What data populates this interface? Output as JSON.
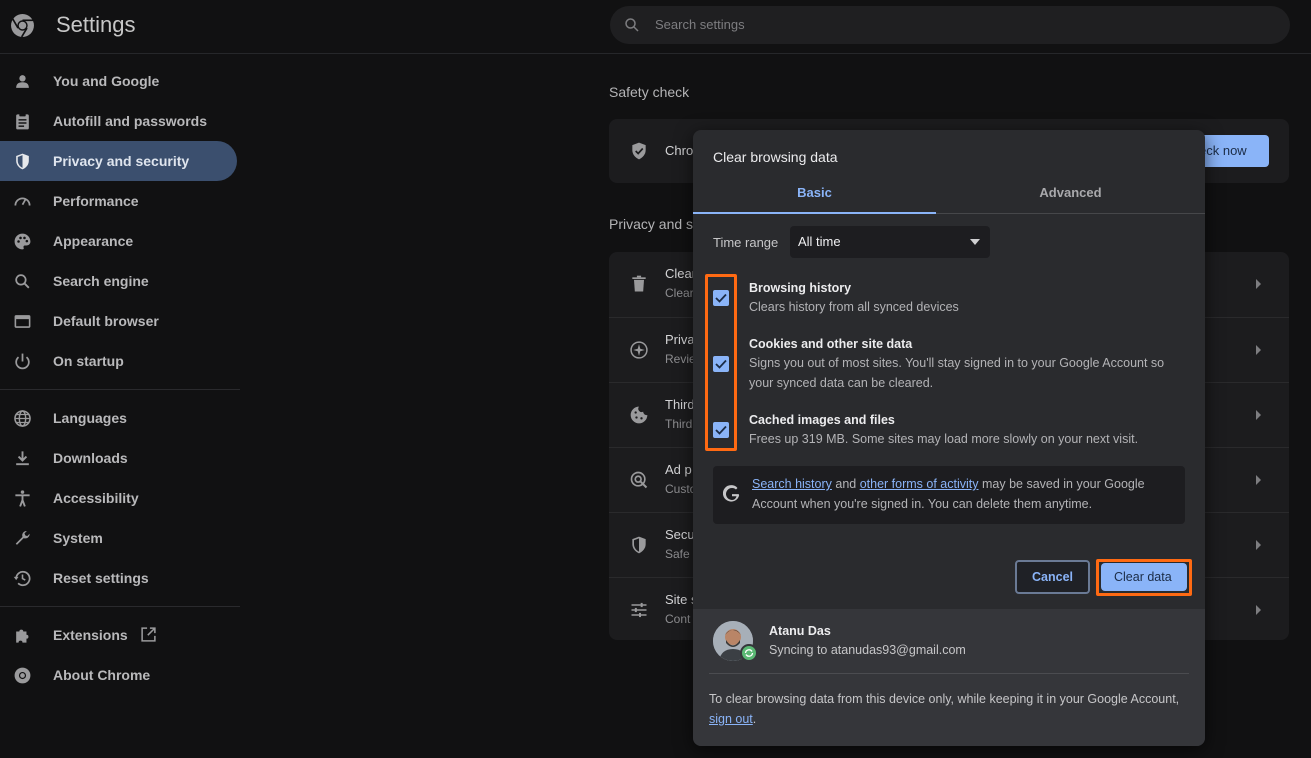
{
  "app": {
    "title": "Settings"
  },
  "search": {
    "placeholder": "Search settings"
  },
  "sidebar": {
    "items": [
      {
        "label": "You and Google",
        "icon": "person-icon"
      },
      {
        "label": "Autofill and passwords",
        "icon": "clipboard-icon"
      },
      {
        "label": "Privacy and security",
        "icon": "shield-icon",
        "active": true
      },
      {
        "label": "Performance",
        "icon": "speedometer-icon"
      },
      {
        "label": "Appearance",
        "icon": "palette-icon"
      },
      {
        "label": "Search engine",
        "icon": "search-icon"
      },
      {
        "label": "Default browser",
        "icon": "browser-icon"
      },
      {
        "label": "On startup",
        "icon": "power-icon"
      }
    ],
    "items2": [
      {
        "label": "Languages",
        "icon": "globe-icon"
      },
      {
        "label": "Downloads",
        "icon": "download-icon"
      },
      {
        "label": "Accessibility",
        "icon": "accessibility-icon"
      },
      {
        "label": "System",
        "icon": "wrench-icon"
      },
      {
        "label": "Reset settings",
        "icon": "history-icon"
      }
    ],
    "items3": [
      {
        "label": "Extensions",
        "icon": "puzzle-icon"
      },
      {
        "label": "About Chrome",
        "icon": "chrome-icon"
      }
    ]
  },
  "main": {
    "safety_title": "Safety check",
    "safety_row_text": "Chro",
    "check_now_label": "eck now",
    "privacy_title": "Privacy and s",
    "rows": [
      {
        "title": "Clear",
        "sub": "Clear",
        "icon": "trash-icon"
      },
      {
        "title": "Priva",
        "sub": "Revie",
        "icon": "compass-icon"
      },
      {
        "title": "Third",
        "sub": "Third",
        "icon": "cookie-icon"
      },
      {
        "title": "Ad p",
        "sub": "Custo",
        "icon": "ad-privacy-icon"
      },
      {
        "title": "Secu",
        "sub": "Safe",
        "icon": "security-shield-icon"
      },
      {
        "title": "Site s",
        "sub": "Cont",
        "icon": "sliders-icon"
      }
    ]
  },
  "dialog": {
    "title": "Clear browsing data",
    "tabs": [
      "Basic",
      "Advanced"
    ],
    "time_range_label": "Time range",
    "time_range_value": "All time",
    "options": [
      {
        "title": "Browsing history",
        "desc": "Clears history from all synced devices",
        "checked": true
      },
      {
        "title": "Cookies and other site data",
        "desc": "Signs you out of most sites. You'll stay signed in to your Google Account so your synced data can be cleared.",
        "checked": true
      },
      {
        "title": "Cached images and files",
        "desc": "Frees up 319 MB. Some sites may load more slowly on your next visit.",
        "checked": true
      }
    ],
    "info": {
      "link1": "Search history",
      "mid": " and ",
      "link2": "other forms of activity",
      "rest": " may be saved in your Google Account when you're signed in. You can delete them anytime."
    },
    "cancel_label": "Cancel",
    "clear_label": "Clear data",
    "account": {
      "name": "Atanu Das",
      "sync": "Syncing to atanudas93@gmail.com"
    },
    "footer_note": "To clear browsing data from this device only, while keeping it in your Google Account, ",
    "footer_link": "sign out",
    "footer_end": "."
  },
  "colors": {
    "accent": "#8ab4f8",
    "highlight": "#ff6a13",
    "background": "#111112",
    "dialog": "#2a2b2e"
  }
}
